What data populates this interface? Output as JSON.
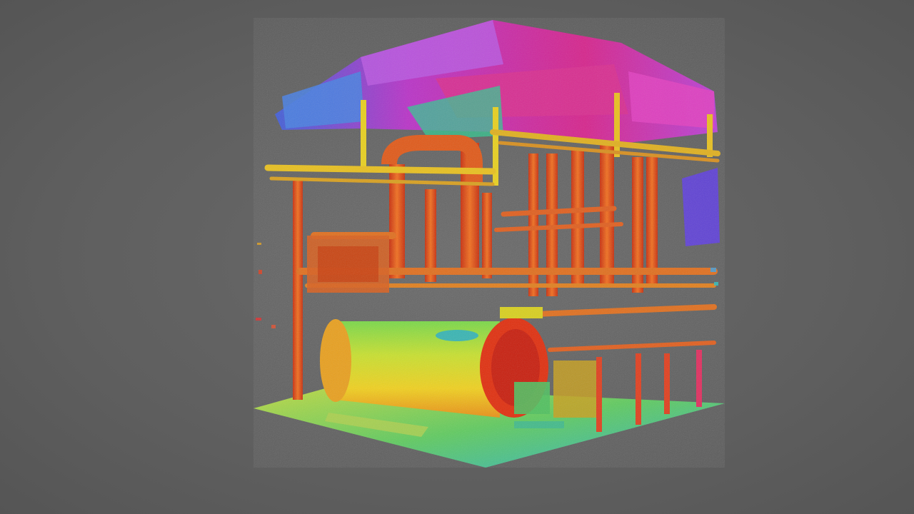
{
  "viewport": {
    "background_color": "#5f5f5f",
    "content": "point-cloud-scan"
  },
  "colors": {
    "floor": "#7fd84a",
    "boiler_body": "#d8d82a",
    "boiler_end": "#e03010",
    "pipes": "#e0601a",
    "racks": "#e8c020",
    "roof_ducts": "#e020b0",
    "ceiling_blue": "#5050e0",
    "cyan_accent": "#30c8d0"
  }
}
